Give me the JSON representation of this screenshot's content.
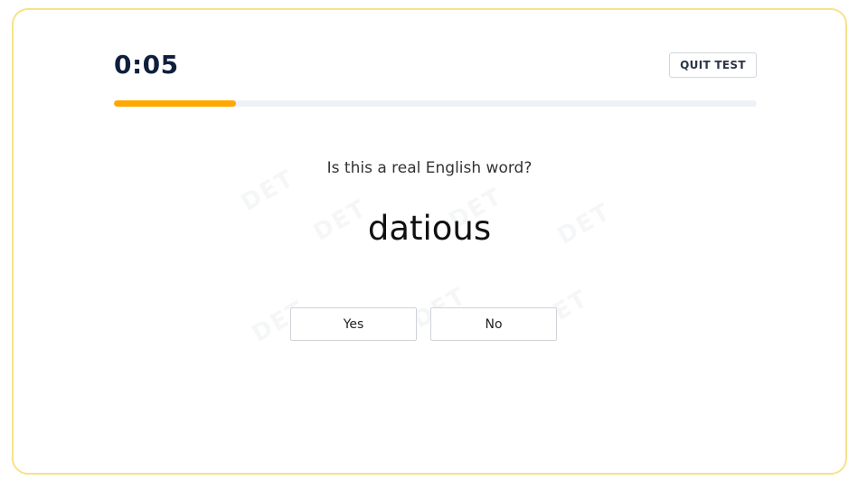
{
  "header": {
    "timer": "0:05",
    "quit_label": "QUIT TEST"
  },
  "progress": {
    "fraction": 0.19,
    "color": "#ffa800",
    "track_color": "#eef2f6"
  },
  "question": {
    "prompt": "Is this a real English word?",
    "word": "datious"
  },
  "answers": {
    "yes_label": "Yes",
    "no_label": "No"
  },
  "theme": {
    "card_border": "#f7e28a",
    "timer_color": "#0f1f3d"
  }
}
